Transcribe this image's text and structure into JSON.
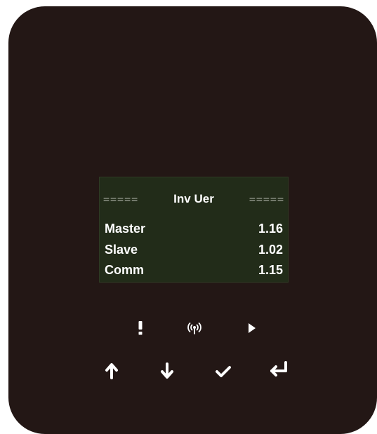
{
  "screen": {
    "title": "Inv Uer",
    "title_decoration": "=====",
    "rows": [
      {
        "label": "Master",
        "value": "1.16"
      },
      {
        "label": "Slave",
        "value": "1.02"
      },
      {
        "label": "Comm",
        "value": "1.15"
      }
    ]
  },
  "indicators": [
    "alarm-icon",
    "wireless-signal-icon",
    "run-play-icon"
  ],
  "keys": [
    "arrow-up-icon",
    "arrow-down-icon",
    "check-icon",
    "enter-icon"
  ],
  "colors": {
    "device_body": "#231715",
    "lcd_background": "#222c19",
    "text": "#ffffff",
    "decoration": "#9ea297"
  }
}
